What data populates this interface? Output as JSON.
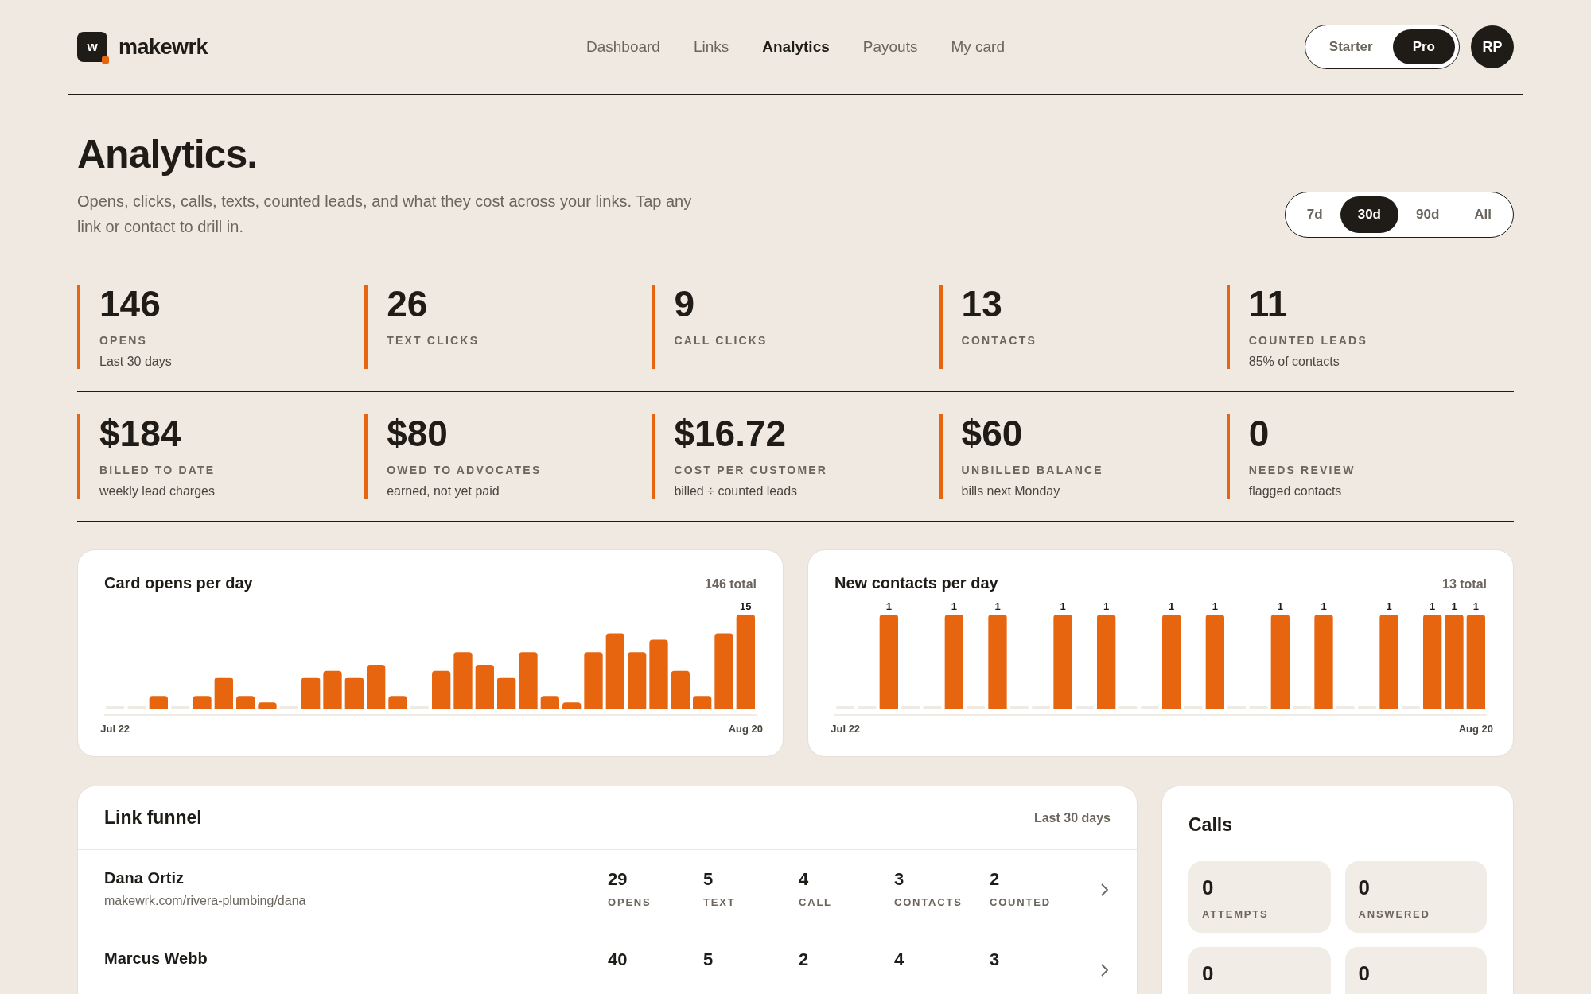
{
  "brand": {
    "logo_letter": "w",
    "name": "makewrk"
  },
  "nav": [
    {
      "label": "Dashboard",
      "selected": false
    },
    {
      "label": "Links",
      "selected": false
    },
    {
      "label": "Analytics",
      "selected": true
    },
    {
      "label": "Payouts",
      "selected": false
    },
    {
      "label": "My card",
      "selected": false
    }
  ],
  "plan_toggle": [
    {
      "label": "Starter",
      "selected": false
    },
    {
      "label": "Pro",
      "selected": true
    }
  ],
  "avatar": "RP",
  "page": {
    "title": "Analytics.",
    "subtitle": "Opens, clicks, calls, texts, counted leads, and what they cost across your links. Tap any link or contact to drill in."
  },
  "range": [
    {
      "label": "7d",
      "selected": false
    },
    {
      "label": "30d",
      "selected": true
    },
    {
      "label": "90d",
      "selected": false
    },
    {
      "label": "All",
      "selected": false
    }
  ],
  "stat_rows": [
    [
      {
        "value": "146",
        "label": "OPENS",
        "note": "Last 30 days"
      },
      {
        "value": "26",
        "label": "TEXT CLICKS"
      },
      {
        "value": "9",
        "label": "CALL CLICKS"
      },
      {
        "value": "13",
        "label": "CONTACTS"
      },
      {
        "value": "11",
        "label": "COUNTED LEADS",
        "note": "85% of contacts"
      }
    ],
    [
      {
        "value": "$184",
        "label": "BILLED TO DATE",
        "note": "weekly lead charges"
      },
      {
        "value": "$80",
        "label": "OWED TO ADVOCATES",
        "note": "earned, not yet paid"
      },
      {
        "value": "$16.72",
        "label": "COST PER CUSTOMER",
        "note": "billed ÷ counted leads"
      },
      {
        "value": "$60",
        "label": "UNBILLED BALANCE",
        "note": "bills next Monday"
      },
      {
        "value": "0",
        "label": "NEEDS REVIEW",
        "note": "flagged contacts"
      }
    ]
  ],
  "charts": [
    {
      "title": "Card opens per day",
      "total": "146 total",
      "chart_data": {
        "type": "bar",
        "categories": [
          "Jul 22",
          null,
          null,
          null,
          null,
          null,
          null,
          null,
          null,
          null,
          null,
          null,
          null,
          null,
          null,
          null,
          null,
          null,
          null,
          null,
          null,
          null,
          null,
          null,
          null,
          null,
          null,
          null,
          null,
          "Aug 20"
        ],
        "values": [
          0,
          0,
          2,
          0,
          2,
          5,
          2,
          1,
          0,
          5,
          6,
          5,
          7,
          2,
          0,
          6,
          9,
          7,
          5,
          9,
          2,
          1,
          9,
          12,
          9,
          11,
          6,
          2,
          12,
          15
        ],
        "value_labels": [
          null,
          null,
          null,
          null,
          null,
          null,
          null,
          null,
          null,
          null,
          null,
          null,
          null,
          null,
          null,
          null,
          null,
          null,
          null,
          null,
          null,
          null,
          null,
          null,
          null,
          null,
          null,
          null,
          null,
          "15"
        ]
      }
    },
    {
      "title": "New contacts per day",
      "total": "13 total",
      "chart_data": {
        "type": "bar",
        "categories": [
          "Jul 22",
          null,
          null,
          null,
          null,
          null,
          null,
          null,
          null,
          null,
          null,
          null,
          null,
          null,
          null,
          null,
          null,
          null,
          null,
          null,
          null,
          null,
          null,
          null,
          null,
          null,
          null,
          null,
          null,
          "Aug 20"
        ],
        "values": [
          0,
          0,
          1,
          0,
          0,
          1,
          0,
          1,
          0,
          0,
          1,
          0,
          1,
          0,
          0,
          1,
          0,
          1,
          0,
          0,
          1,
          0,
          1,
          0,
          0,
          1,
          0,
          1,
          1,
          1
        ],
        "value_labels": [
          null,
          null,
          "1",
          null,
          null,
          "1",
          null,
          "1",
          null,
          null,
          "1",
          null,
          "1",
          null,
          null,
          "1",
          null,
          "1",
          null,
          null,
          "1",
          null,
          "1",
          null,
          null,
          "1",
          null,
          "1",
          "1",
          "1"
        ]
      }
    }
  ],
  "link_funnel": {
    "title": "Link funnel",
    "period": "Last 30 days",
    "rows": [
      {
        "name": "Dana Ortiz",
        "url": "makewrk.com/rivera-plumbing/dana",
        "metrics": [
          {
            "value": "29",
            "label": "OPENS"
          },
          {
            "value": "5",
            "label": "TEXT"
          },
          {
            "value": "4",
            "label": "CALL"
          },
          {
            "value": "3",
            "label": "CONTACTS"
          },
          {
            "value": "2",
            "label": "COUNTED"
          }
        ]
      },
      {
        "name": "Marcus Webb",
        "metrics": [
          {
            "value": "40"
          },
          {
            "value": "5"
          },
          {
            "value": "2"
          },
          {
            "value": "4"
          },
          {
            "value": "3"
          }
        ]
      }
    ]
  },
  "calls": {
    "title": "Calls",
    "tiles": [
      {
        "value": "0",
        "label": "ATTEMPTS"
      },
      {
        "value": "0",
        "label": "ANSWERED"
      },
      {
        "value": "0"
      },
      {
        "value": "0"
      }
    ]
  }
}
